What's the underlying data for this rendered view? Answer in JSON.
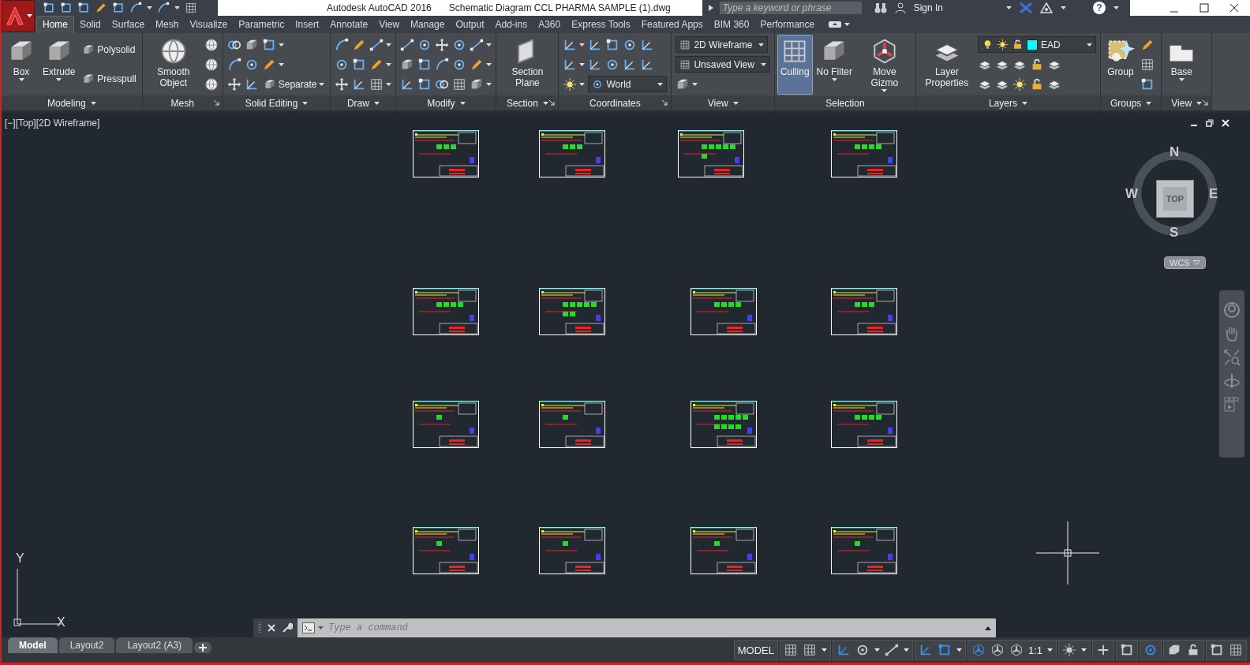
{
  "title_bar": {
    "app_title": "Autodesk AutoCAD 2016",
    "document": "Schematic Diagram CCL PHARMA SAMPLE (1).dwg",
    "search_placeholder": "Type a keyword or phrase",
    "sign_in": "Sign In",
    "help": "?"
  },
  "ribbon_tabs": [
    {
      "label": "Home",
      "selected": true
    },
    {
      "label": "Solid",
      "selected": false
    },
    {
      "label": "Surface",
      "selected": false
    },
    {
      "label": "Mesh",
      "selected": false
    },
    {
      "label": "Visualize",
      "selected": false
    },
    {
      "label": "Parametric",
      "selected": false
    },
    {
      "label": "Insert",
      "selected": false
    },
    {
      "label": "Annotate",
      "selected": false
    },
    {
      "label": "View",
      "selected": false
    },
    {
      "label": "Manage",
      "selected": false
    },
    {
      "label": "Output",
      "selected": false
    },
    {
      "label": "Add-ins",
      "selected": false
    },
    {
      "label": "A360",
      "selected": false
    },
    {
      "label": "Express Tools",
      "selected": false
    },
    {
      "label": "Featured Apps",
      "selected": false
    },
    {
      "label": "BIM 360",
      "selected": false
    },
    {
      "label": "Performance",
      "selected": false
    }
  ],
  "panels": [
    {
      "title": "Modeling",
      "menu": true,
      "large": [
        {
          "label": "Box",
          "dropdown": true,
          "active": false
        },
        {
          "label": "Extrude",
          "dropdown": true,
          "active": false
        }
      ],
      "rows": [
        [
          {
            "kind": "labeled",
            "label": "Polysolid"
          }
        ],
        [
          {
            "kind": "labeled",
            "label": "Presspull"
          }
        ]
      ]
    },
    {
      "title": "Mesh",
      "launcher": true,
      "large": [
        {
          "label": "Smooth Object",
          "active": false
        }
      ],
      "rows": [
        [
          {
            "kind": "icon"
          }
        ],
        [
          {
            "kind": "icon"
          }
        ],
        [
          {
            "kind": "icon"
          }
        ]
      ]
    },
    {
      "title": "Solid Editing",
      "menu": true,
      "rows": [
        [
          {
            "kind": "icon"
          },
          {
            "kind": "icon"
          },
          {
            "kind": "icon",
            "dropdown": true
          }
        ],
        [
          {
            "kind": "icon"
          },
          {
            "kind": "icon"
          },
          {
            "kind": "icon",
            "dropdown": true
          }
        ],
        [
          {
            "kind": "icon"
          },
          {
            "kind": "icon"
          },
          {
            "kind": "labeled",
            "label": "Separate",
            "dropdown": true
          }
        ]
      ]
    },
    {
      "title": "Draw",
      "menu": true,
      "rows": [
        [
          {
            "kind": "icon"
          },
          {
            "kind": "icon"
          },
          {
            "kind": "icon",
            "dropdown": true
          }
        ],
        [
          {
            "kind": "icon"
          },
          {
            "kind": "icon"
          },
          {
            "kind": "icon",
            "dropdown": true
          }
        ],
        [
          {
            "kind": "icon"
          },
          {
            "kind": "icon"
          },
          {
            "kind": "icon",
            "dropdown": true
          }
        ]
      ]
    },
    {
      "title": "Modify",
      "menu": true,
      "rows": [
        [
          {
            "kind": "icon"
          },
          {
            "kind": "icon"
          },
          {
            "kind": "icon"
          },
          {
            "kind": "icon"
          },
          {
            "kind": "icon",
            "dropdown": true
          }
        ],
        [
          {
            "kind": "icon"
          },
          {
            "kind": "icon"
          },
          {
            "kind": "icon"
          },
          {
            "kind": "icon"
          },
          {
            "kind": "icon",
            "dropdown": true
          }
        ],
        [
          {
            "kind": "icon"
          },
          {
            "kind": "icon"
          },
          {
            "kind": "icon"
          },
          {
            "kind": "icon"
          },
          {
            "kind": "icon",
            "dropdown": true
          }
        ]
      ]
    },
    {
      "title": "Section",
      "menu": true,
      "launcher": true,
      "large": [
        {
          "label": "Section Plane",
          "active": false
        }
      ]
    },
    {
      "title": "Coordinates",
      "launcher": true,
      "rows": [
        [
          {
            "kind": "icon",
            "dropdown": true
          },
          {
            "kind": "icon"
          },
          {
            "kind": "icon"
          },
          {
            "kind": "icon"
          },
          {
            "kind": "icon"
          }
        ],
        [
          {
            "kind": "icon",
            "dropdown": true
          },
          {
            "kind": "icon"
          },
          {
            "kind": "icon"
          },
          {
            "kind": "icon"
          },
          {
            "kind": "icon"
          }
        ],
        [
          {
            "kind": "icon",
            "dropdown": true
          },
          {
            "kind": "combo",
            "label": "World"
          }
        ]
      ]
    },
    {
      "title": "View",
      "menu": true,
      "rows": [
        [
          {
            "kind": "combo",
            "label": "2D Wireframe"
          }
        ],
        [
          {
            "kind": "combo",
            "label": "Unsaved View"
          }
        ],
        [
          {
            "kind": "icon",
            "dropdown": true
          }
        ]
      ]
    },
    {
      "title": "Selection",
      "large": [
        {
          "label": "Culling",
          "active": true
        },
        {
          "label": "No Filter",
          "dropdown": true,
          "active": false
        },
        {
          "label": "Move Gizmo",
          "dropdown": true,
          "active": false
        }
      ]
    },
    {
      "title": "Layers",
      "menu": true,
      "large": [
        {
          "label": "Layer Properties",
          "active": false
        }
      ],
      "rows": [
        [
          {
            "kind": "layer",
            "label": "EAD",
            "color": "#00ffff"
          }
        ],
        [
          {
            "kind": "icon"
          },
          {
            "kind": "icon"
          },
          {
            "kind": "icon"
          },
          {
            "kind": "icon"
          },
          {
            "kind": "icon"
          }
        ],
        [
          {
            "kind": "icon"
          },
          {
            "kind": "icon"
          },
          {
            "kind": "icon"
          },
          {
            "kind": "icon"
          },
          {
            "kind": "icon"
          }
        ]
      ]
    },
    {
      "title": "Groups",
      "menu": true,
      "large": [
        {
          "label": "Group",
          "active": false
        }
      ],
      "rows": [
        [
          {
            "kind": "icon"
          }
        ],
        [
          {
            "kind": "icon"
          }
        ],
        [
          {
            "kind": "icon"
          }
        ]
      ]
    },
    {
      "title": "View",
      "menu": true,
      "launcher": true,
      "large": [
        {
          "label": "Base",
          "dropdown": true,
          "active": false
        }
      ]
    }
  ],
  "viewport": {
    "label": "[−][Top][2D Wireframe]",
    "viewcube": {
      "north": "N",
      "east": "E",
      "south": "S",
      "west": "W",
      "face": "TOP",
      "ucs_menu": "WCS"
    },
    "ucs": {
      "x_axis": "X",
      "y_axis": "Y"
    }
  },
  "command_line": {
    "placeholder": "Type a command"
  },
  "layout_tabs": [
    {
      "label": "Model",
      "selected": true
    },
    {
      "label": "Layout2",
      "selected": false
    },
    {
      "label": "Layout2 (A3)",
      "selected": false
    }
  ],
  "status_bar": [
    [
      {
        "kind": "text",
        "label": "MODEL",
        "on": false
      }
    ],
    [
      {
        "kind": "icon",
        "on": false
      },
      {
        "kind": "icon",
        "on": false,
        "dropdown": true
      }
    ],
    [
      {
        "kind": "icon",
        "on": true
      },
      {
        "kind": "icon",
        "on": false,
        "dropdown": true
      },
      {
        "kind": "icon",
        "on": false,
        "dropdown": true
      }
    ],
    [
      {
        "kind": "icon",
        "on": true
      },
      {
        "kind": "icon",
        "on": true,
        "dropdown": true
      }
    ],
    [
      {
        "kind": "icon",
        "on": true
      },
      {
        "kind": "icon",
        "on": false
      },
      {
        "kind": "icon",
        "on": false
      },
      {
        "kind": "text",
        "label": "1:1",
        "on": false,
        "dropdown": true
      }
    ],
    [
      {
        "kind": "icon",
        "on": false,
        "dropdown": true
      }
    ],
    [
      {
        "kind": "icon",
        "on": false
      }
    ],
    [
      {
        "kind": "icon",
        "on": false
      }
    ],
    [
      {
        "kind": "icon",
        "on": true
      }
    ],
    [
      {
        "kind": "icon",
        "on": false
      },
      {
        "kind": "icon",
        "on": false
      }
    ],
    [
      {
        "kind": "icon",
        "on": false
      },
      {
        "kind": "icon",
        "on": false
      }
    ]
  ]
}
